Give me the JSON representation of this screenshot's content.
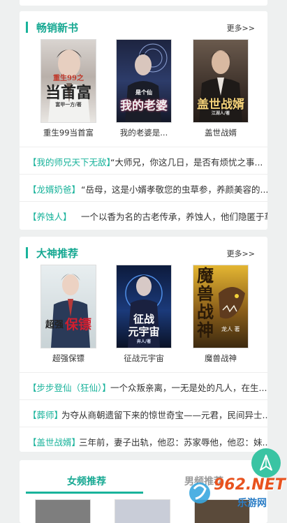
{
  "sections": [
    {
      "title": "畅销新书",
      "more": "更多>>",
      "books": [
        {
          "title": "重生99当首富",
          "cover": {
            "line1": "重生99之",
            "line2": "当首富",
            "author": "富甲一方/著"
          }
        },
        {
          "title": "我的老婆是...",
          "cover": {
            "line1": "我的老婆",
            "line2": "是个仙",
            "author": ""
          }
        },
        {
          "title": "盖世战婿",
          "cover": {
            "line1": "盖世战婿",
            "line2": "",
            "author": "江湖人/著"
          }
        }
      ],
      "rows": [
        {
          "tag": "【我的师兄天下无敌】",
          "text": "“大师兄，你这几日，是否有烦忧之事..."
        },
        {
          "tag": "【龙婿奶爸】",
          "text": "“岳母，这是小婿孝敬您的虫草参，养颜美容的..."
        },
        {
          "tag": "【养蚀人】",
          "text": "一个以香为名的古老传承，养蚀人，他们隐匿于草..."
        }
      ]
    },
    {
      "title": "大神推荐",
      "more": "更多>>",
      "books": [
        {
          "title": "超强保镖",
          "cover": {
            "line1": "超强",
            "line2": "保镖",
            "author": ""
          }
        },
        {
          "title": "征战元宇宙",
          "cover": {
            "line1": "征战",
            "line2": "元宇宙",
            "author": "奔人/著"
          }
        },
        {
          "title": "魔兽战神",
          "cover": {
            "line1": "魔兽",
            "line2": "战神",
            "author": "龙人 著"
          }
        }
      ],
      "rows": [
        {
          "tag": "【步步登仙（狂仙）】",
          "text": "一个众叛亲离，一无是处的凡人，在生..."
        },
        {
          "tag": "【葬师】",
          "text": "为夺从商朝遗留下来的惊世奇宝——元君，民间异士..."
        },
        {
          "tag": "【盖世战婿】",
          "text": "三年前，妻子出轨，他忍：苏家辱他，他忍：妹..."
        }
      ]
    }
  ],
  "tabs": {
    "active": "女频推荐",
    "other": "男频推荐"
  },
  "watermark": {
    "brand": "962.NET",
    "sub": "乐游网"
  },
  "colors": {
    "accent": "#19b39b"
  }
}
